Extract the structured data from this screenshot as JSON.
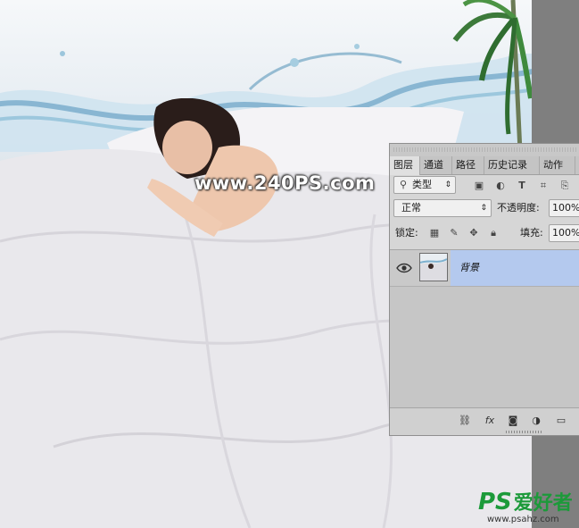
{
  "watermark": {
    "text": "www.240PS.com"
  },
  "logo": {
    "main": "PS",
    "cn": "爱好者",
    "url": "www.psahz.com"
  },
  "layers_panel": {
    "tabs": [
      {
        "label": "图层",
        "active": true
      },
      {
        "label": "通道",
        "active": false
      },
      {
        "label": "路径",
        "active": false
      },
      {
        "label": "历史记录",
        "active": false
      },
      {
        "label": "动作",
        "active": false
      }
    ],
    "filter": {
      "value": "类型",
      "icon": "search-icon"
    },
    "blend_mode": {
      "value": "正常"
    },
    "opacity": {
      "label": "不透明度:",
      "value": "100%"
    },
    "lock": {
      "label": "锁定:"
    },
    "fill": {
      "label": "填充:",
      "value": "100%"
    },
    "layers": [
      {
        "name": "背景",
        "visible": true,
        "selected": true
      }
    ]
  },
  "colors": {
    "selection": "#b4c9ee",
    "panel": "#d6d6d6",
    "gutter": "#7f7f7f"
  }
}
